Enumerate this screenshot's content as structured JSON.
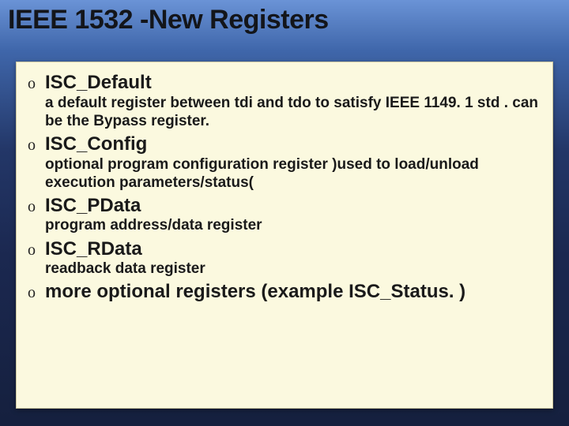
{
  "title": "IEEE 1532 -New Registers",
  "bullet_char": "o",
  "items": [
    {
      "term": "ISC_Default",
      "desc": "a default register between tdi and tdo to satisfy IEEE 1149. 1 std . can be the Bypass register."
    },
    {
      "term": "ISC_Config",
      "desc": "optional program configuration  register )used to load/unload execution parameters/status("
    },
    {
      "term": "ISC_PData",
      "desc": "program address/data register"
    },
    {
      "term": "ISC_RData",
      "desc": "readback data register"
    },
    {
      "term": "more optional registers (example ISC_Status. )",
      "desc": ""
    }
  ]
}
